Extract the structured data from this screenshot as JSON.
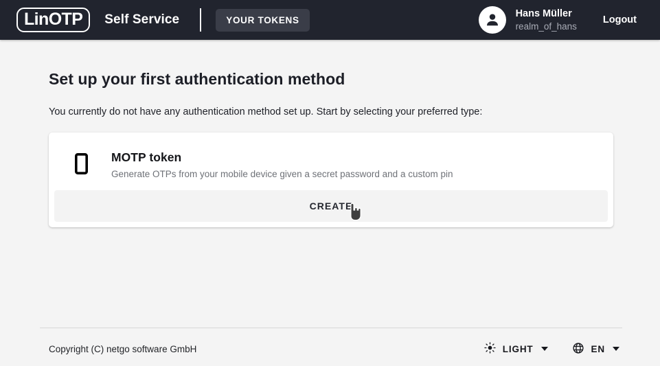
{
  "header": {
    "logo_text": "LinOTP",
    "app_title": "Self Service",
    "tab_label": "YOUR TOKENS",
    "user_name": "Hans Müller",
    "user_realm": "realm_of_hans",
    "logout_label": "Logout",
    "background_color": "#21242e",
    "tab_background_color": "#3a3d48"
  },
  "main": {
    "title": "Set up your first authentication method",
    "subtitle": "You currently do not have any authentication method set up. Start by selecting your preferred type:",
    "token": {
      "name": "MOTP token",
      "description": "Generate OTPs from your mobile device given a secret password and a custom pin",
      "icon": "smartphone-icon"
    },
    "create_label": "CREATE"
  },
  "footer": {
    "copyright": "Copyright (C) netgo software GmbH",
    "theme_label": "LIGHT",
    "theme_icon": "brightness-sun-icon",
    "language_label": "EN",
    "language_icon": "globe-icon"
  },
  "cursor": {
    "type": "pointer-hand-cursor"
  }
}
